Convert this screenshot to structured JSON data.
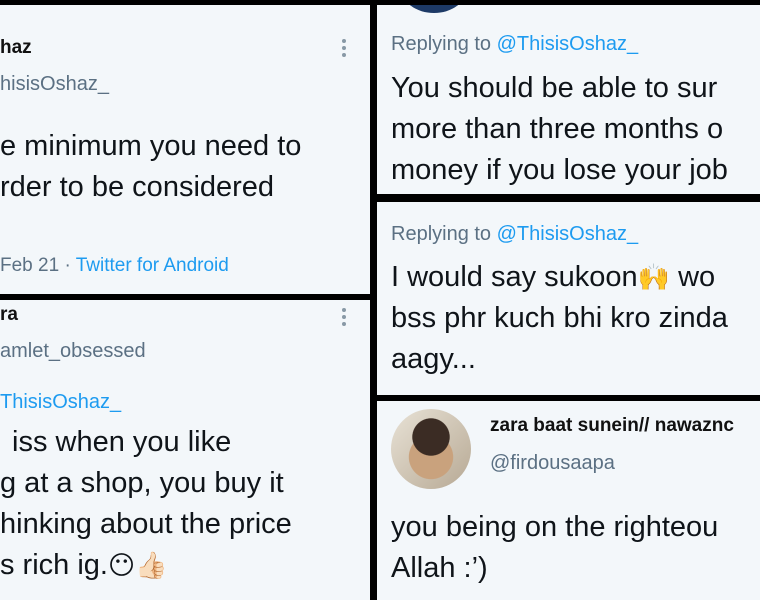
{
  "tile1": {
    "name": "haz",
    "handle": "hisisOshaz_",
    "lines": [
      "e minimum you need to",
      "rder to be considered"
    ],
    "date": "Feb 21",
    "separator": "·",
    "app": "Twitter for Android"
  },
  "tile2": {
    "name": "ra",
    "handle": "amlet_obsessed",
    "mention": "ThisisOshaz_",
    "lines": [
      "iss when you like",
      "g at a shop, you buy it",
      "hinking about the price",
      "s rich ig."
    ],
    "emoji1": "😶",
    "emoji2": "👍🏻"
  },
  "tile3": {
    "reply_prefix": "Replying to",
    "mention": "@ThisisOshaz_",
    "lines": [
      "You should be able to sur",
      "more than three months o",
      "money if you lose your job"
    ]
  },
  "tile4": {
    "reply_prefix": "Replying to",
    "mention": "@ThisisOshaz_",
    "line1_a": "I would say sukoon",
    "line1_emoji": "🙌",
    "line1_b": "wo",
    "line2": "bss phr kuch bhi kro zinda",
    "line3": "aagy..."
  },
  "tile5": {
    "name": "zara baat sunein// nawaznc",
    "handle": "@firdousaapa",
    "lines": [
      "you being on the righteou",
      "Allah :’)"
    ]
  }
}
